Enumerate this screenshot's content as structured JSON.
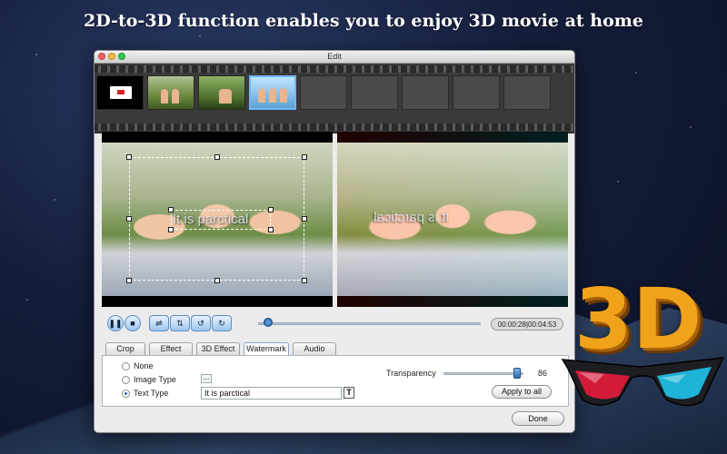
{
  "headline": "2D-to-3D function enables you to enjoy 3D movie at home",
  "window": {
    "title": "Edit"
  },
  "preview": {
    "watermark_text": "It is parctical"
  },
  "transport": {
    "timecode": "00:00:28|00:04:53",
    "progress": 0.03
  },
  "tabs": [
    {
      "label": "Crop"
    },
    {
      "label": "Effect"
    },
    {
      "label": "3D Effect"
    },
    {
      "label": "Watermark",
      "active": true
    },
    {
      "label": "Audio"
    }
  ],
  "watermark": {
    "options": [
      {
        "label": "None",
        "selected": false
      },
      {
        "label": "Image Type",
        "selected": false
      },
      {
        "label": "Text Type",
        "selected": true
      }
    ],
    "more_button": "...",
    "text_value": "It is parctical",
    "text_button": "T",
    "transparency_label": "Transparency",
    "transparency_value": "86",
    "apply_label": "Apply to all"
  },
  "done_label": "Done",
  "badge_text": "3D",
  "colors": {
    "accent": "#2a66c8",
    "badge": "#f0a21a"
  }
}
